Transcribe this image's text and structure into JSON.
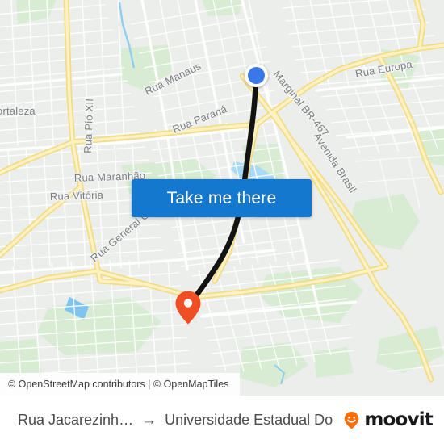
{
  "map": {
    "background_color": "#e9ebe9",
    "road_major_color": "#f7e08a",
    "road_minor_color": "#ffffff",
    "park_color": "#d6ecd2",
    "water_color": "#9ed2f2",
    "route_color": "#131313",
    "labels": [
      {
        "name": "rua-manaus",
        "text": "Rua Manaus"
      },
      {
        "name": "rua-europa",
        "text": "Rua Europa"
      },
      {
        "name": "marginal-br-467",
        "text": "Marginal BR-467"
      },
      {
        "name": "rua-parana",
        "text": "Rua Paraná"
      },
      {
        "name": "avenida-brasil",
        "text": "Avenida Brasil"
      },
      {
        "name": "rua-pio-xii",
        "text": "Rua Pio XII"
      },
      {
        "name": "fortaleza",
        "text": "ortaleza"
      },
      {
        "name": "rua-maranhao",
        "text": "Rua Maranhão"
      },
      {
        "name": "rua-vitoria",
        "text": "Rua Vitória"
      },
      {
        "name": "rua-general-osorio",
        "text": "Rua General Osório"
      }
    ],
    "origin_marker": {
      "name": "origin-dot",
      "color": "#3b78e7",
      "ring_color": "#ffffff"
    },
    "destination_marker": {
      "name": "destination-pin",
      "color": "#f04e23"
    }
  },
  "button": {
    "take_me_there_label": "Take me there",
    "color": "#1478cf",
    "text_color": "#ffffff"
  },
  "attribution": {
    "text": "© OpenStreetMap contributors | © OpenMapTiles"
  },
  "bottom_bar": {
    "origin": "Rua Jacarezinh…",
    "arrow": "→",
    "destination": "Universidade Estadual Do Oeste…",
    "brand": "moovit",
    "brand_color": "#ff6d00"
  }
}
